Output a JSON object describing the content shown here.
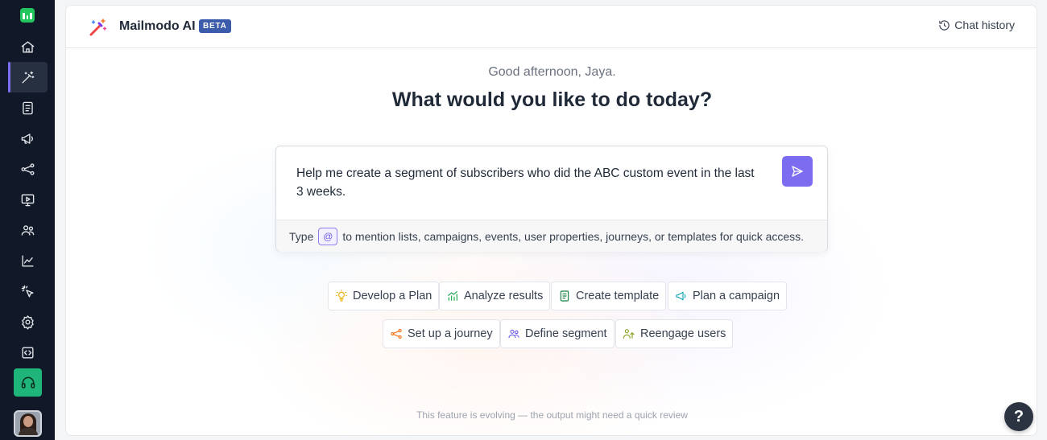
{
  "sidebar": {
    "logo": "mailmodo-logo",
    "items": [
      {
        "name": "home",
        "icon": "home-icon"
      },
      {
        "name": "ai",
        "icon": "magic-wand-icon",
        "active": true
      },
      {
        "name": "templates",
        "icon": "document-icon"
      },
      {
        "name": "campaigns",
        "icon": "megaphone-icon"
      },
      {
        "name": "journeys",
        "icon": "share-nodes-icon"
      },
      {
        "name": "widgets",
        "icon": "screen-icon"
      },
      {
        "name": "contacts",
        "icon": "users-icon"
      },
      {
        "name": "analytics",
        "icon": "line-chart-icon"
      },
      {
        "name": "tracking",
        "icon": "cursor-click-icon"
      },
      {
        "name": "settings",
        "icon": "gear-icon"
      },
      {
        "name": "developer",
        "icon": "code-icon"
      }
    ],
    "support_icon": "headset-icon"
  },
  "header": {
    "brand": "Mailmodo AI",
    "badge": "BETA",
    "chat_history": "Chat history"
  },
  "main": {
    "greeting": "Good afternoon, Jaya.",
    "headline": "What would you like to do today?",
    "prompt": {
      "text": "Help me create a segment of subscribers who did the ABC custom event in the last 3 weeks.",
      "hint_prefix": "Type",
      "hint_chip": "@",
      "hint_suffix": "to mention lists, campaigns, events, user properties, journeys, or templates for quick access."
    },
    "suggestions": [
      {
        "label": "Develop a Plan",
        "icon": "lightbulb-icon",
        "color": "#eab308"
      },
      {
        "label": "Analyze results",
        "icon": "bar-chart-icon",
        "color": "#16a34a"
      },
      {
        "label": "Create template",
        "icon": "template-icon",
        "color": "#15803d"
      },
      {
        "label": "Plan a campaign",
        "icon": "megaphone-icon",
        "color": "#0ea5b7"
      },
      {
        "label": "Set up a journey",
        "icon": "share-nodes-icon",
        "color": "#f97316"
      },
      {
        "label": "Define segment",
        "icon": "users-icon",
        "color": "#6d5ee8"
      },
      {
        "label": "Reengage users",
        "icon": "user-arrow-icon",
        "color": "#84a11f"
      }
    ],
    "disclaimer": "This feature is evolving — the output might need a quick review"
  },
  "help": {
    "label": "?"
  },
  "colors": {
    "accent": "#7b6cf0",
    "sidebar": "#111827",
    "support": "#1fb57a",
    "beta": "#3b5bab"
  }
}
